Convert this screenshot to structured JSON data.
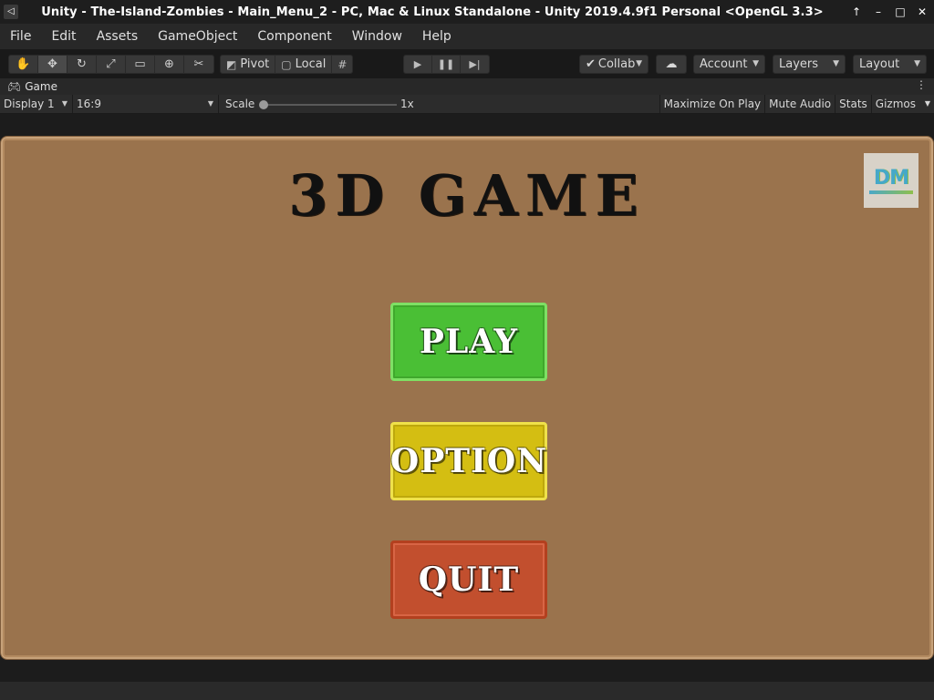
{
  "window": {
    "title": "Unity - The-Island-Zombies - Main_Menu_2 - PC, Mac & Linux Standalone - Unity 2019.4.9f1 Personal <OpenGL 3.3>",
    "controls": [
      "↑",
      "–",
      "□",
      "✕"
    ]
  },
  "menubar": [
    "File",
    "Edit",
    "Assets",
    "GameObject",
    "Component",
    "Window",
    "Help"
  ],
  "toolbar": {
    "tools": [
      "hand-tool",
      "move-tool",
      "rotate-tool",
      "scale-tool",
      "rect-tool",
      "transform-tool",
      "custom-tool"
    ],
    "pivot_label": "Pivot",
    "local_label": "Local",
    "collab_label": "Collab",
    "account_label": "Account",
    "layers_label": "Layers",
    "layout_label": "Layout"
  },
  "game_tab": {
    "label": "Game"
  },
  "game_toolbar": {
    "display": "Display 1",
    "aspect": "16:9",
    "scale_label": "Scale",
    "scale_value": "1x",
    "maximize": "Maximize On Play",
    "mute": "Mute Audio",
    "stats": "Stats",
    "gizmos": "Gizmos"
  },
  "game_view": {
    "title": "3D GAME",
    "logo_text": "DM",
    "buttons": {
      "play": "PLAY",
      "option": "OPTION",
      "quit": "QUIT"
    }
  },
  "colors": {
    "panel": "#9a734d",
    "play": "#4abf35",
    "option": "#d4be12",
    "quit": "#c24f2e"
  }
}
